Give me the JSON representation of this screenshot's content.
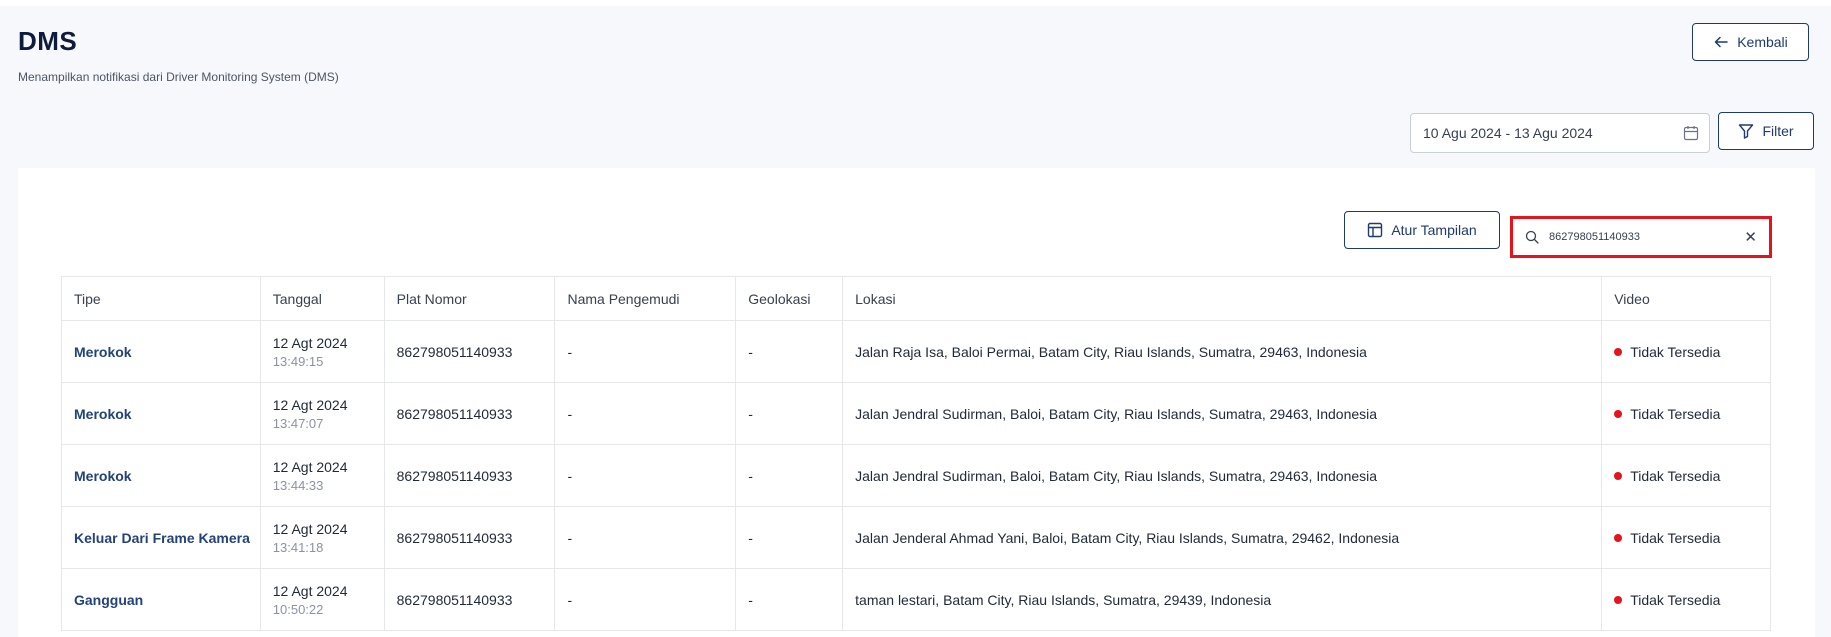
{
  "header": {
    "title": "DMS",
    "subtitle": "Menampilkan notifikasi dari Driver Monitoring System (DMS)",
    "back_label": "Kembali"
  },
  "filters": {
    "date_range": "10 Agu 2024 - 13 Agu 2024",
    "filter_label": "Filter"
  },
  "toolbar": {
    "layout_label": "Atur Tampilan",
    "search_value": "862798051140933"
  },
  "table": {
    "columns": [
      "Tipe",
      "Tanggal",
      "Plat Nomor",
      "Nama Pengemudi",
      "Geolokasi",
      "Lokasi",
      "Video"
    ],
    "rows": [
      {
        "type": "Merokok",
        "date": "12 Agt 2024",
        "time": "13:49:15",
        "plate": "862798051140933",
        "driver": "-",
        "geo": "-",
        "location": "Jalan Raja Isa, Baloi Permai, Batam City, Riau Islands, Sumatra, 29463, Indonesia",
        "video": "Tidak Tersedia"
      },
      {
        "type": "Merokok",
        "date": "12 Agt 2024",
        "time": "13:47:07",
        "plate": "862798051140933",
        "driver": "-",
        "geo": "-",
        "location": "Jalan Jendral Sudirman, Baloi, Batam City, Riau Islands, Sumatra, 29463, Indonesia",
        "video": "Tidak Tersedia"
      },
      {
        "type": "Merokok",
        "date": "12 Agt 2024",
        "time": "13:44:33",
        "plate": "862798051140933",
        "driver": "-",
        "geo": "-",
        "location": "Jalan Jendral Sudirman, Baloi, Batam City, Riau Islands, Sumatra, 29463, Indonesia",
        "video": "Tidak Tersedia"
      },
      {
        "type": "Keluar Dari Frame Kamera",
        "date": "12 Agt 2024",
        "time": "13:41:18",
        "plate": "862798051140933",
        "driver": "-",
        "geo": "-",
        "location": "Jalan Jenderal Ahmad Yani, Baloi, Batam City, Riau Islands, Sumatra, 29462, Indonesia",
        "video": "Tidak Tersedia"
      },
      {
        "type": "Gangguan",
        "date": "12 Agt 2024",
        "time": "10:50:22",
        "plate": "862798051140933",
        "driver": "-",
        "geo": "-",
        "location": "taman lestari, Batam City, Riau Islands, Sumatra, 29439, Indonesia",
        "video": "Tidak Tersedia"
      }
    ]
  },
  "colors": {
    "accent": "#1e3a6e",
    "link": "#24427a",
    "status_unavailable": "#e3141b",
    "highlight_border": "#e3141b"
  }
}
